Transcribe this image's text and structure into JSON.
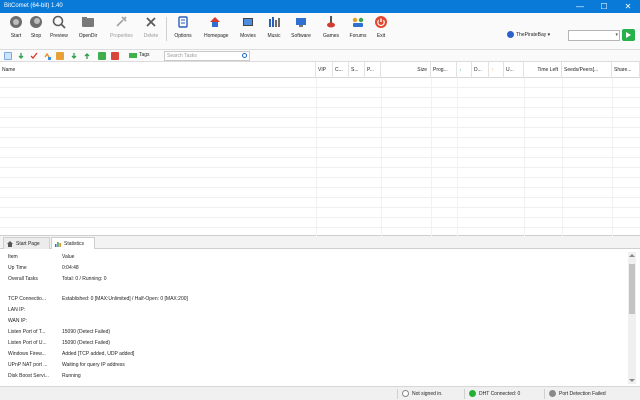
{
  "window": {
    "title": "BitComet (64-bit) 1.40",
    "minimize": "—",
    "maximize": "☐",
    "close": "✕"
  },
  "toolbar": {
    "start": "Start",
    "stop": "Stop",
    "preview": "Preview",
    "open_dir": "OpenDir",
    "properties": "Properties",
    "delete": "Delete",
    "options": "Options",
    "homepage": "Homepage",
    "movies": "Movies",
    "music": "Music",
    "software": "Software",
    "games": "Games",
    "forums": "Forums",
    "exit": "Exit",
    "search_engine": "ThePirateBay",
    "search_value": ""
  },
  "toolbar2": {
    "tags_label": "Tags",
    "filter_placeholder": "Search Tasks"
  },
  "task_table": {
    "columns": [
      "Name",
      "VIP",
      "C...",
      "S...",
      "P...",
      "Size",
      "Prog...",
      "↓",
      "D...",
      "↑",
      "U...",
      "Time Left",
      "Seeds/Peers[...",
      "Share..."
    ]
  },
  "tabs": {
    "start_page": "Start Page",
    "statistics": "Statistics"
  },
  "statistics": {
    "rows": [
      {
        "key": "Item",
        "value": "Value"
      },
      {
        "key": "Up Time",
        "value": "0:04:48"
      },
      {
        "key": "Overall Tasks",
        "value": "Total: 0 / Running: 0"
      },
      {
        "key": "",
        "value": ""
      },
      {
        "key": "TCP Connectio...",
        "value": "Established: 0 [MAX:Unlimited] / Half-Open: 0 [MAX:200]"
      },
      {
        "key": "LAN IP:",
        "value": ""
      },
      {
        "key": "WAN IP:",
        "value": ""
      },
      {
        "key": "Listen Port of T...",
        "value": "15090 (Detect Failed)"
      },
      {
        "key": "Listen Port of U...",
        "value": "15090 (Detect Failed)"
      },
      {
        "key": "Windows Firew...",
        "value": "Added [TCP added, UDP added]"
      },
      {
        "key": "UPnP NAT port ...",
        "value": "Waiting for query IP address"
      },
      {
        "key": "Disk Boost Servi...",
        "value": "Running"
      }
    ]
  },
  "statusbar": {
    "sign_in": "Not signed in.",
    "dht": "DHT Connected: 0",
    "port": "Port Detection Failed"
  },
  "colors": {
    "titlebar": "#0a7ad9",
    "dht_dot": "#22b035",
    "port_dot": "#8a8a8a"
  }
}
